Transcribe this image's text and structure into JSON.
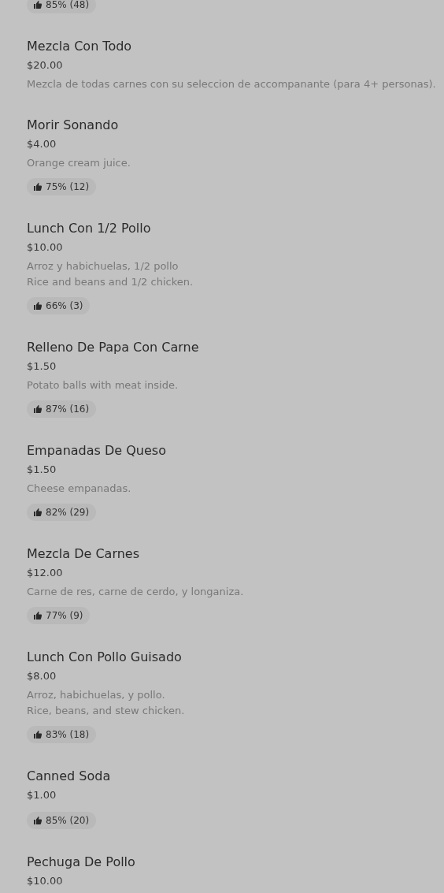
{
  "menu_items": [
    {
      "rating": "85% (48)"
    },
    {
      "name": "Mezcla Con Todo",
      "price": "$20.00",
      "description": [
        "Mezcla de todas carnes con su seleccion de accompanante (para 4+ personas)."
      ]
    },
    {
      "name": "Morir Sonando",
      "price": "$4.00",
      "description": [
        "Orange cream juice."
      ],
      "rating": "75% (12)"
    },
    {
      "name": "Lunch Con 1/2 Pollo",
      "price": "$10.00",
      "description": [
        "Arroz y habichuelas, 1/2 pollo",
        "Rice and beans and 1/2 chicken."
      ],
      "rating": "66% (3)"
    },
    {
      "name": "Relleno De Papa Con Carne",
      "price": "$1.50",
      "description": [
        "Potato balls with meat inside."
      ],
      "rating": "87% (16)"
    },
    {
      "name": "Empanadas De Queso",
      "price": "$1.50",
      "description": [
        "Cheese empanadas."
      ],
      "rating": "82% (29)"
    },
    {
      "name": "Mezcla De Carnes",
      "price": "$12.00",
      "description": [
        "Carne de res, carne de cerdo, y longaniza."
      ],
      "rating": "77% (9)"
    },
    {
      "name": "Lunch Con Pollo Guisado",
      "price": "$8.00",
      "description": [
        "Arroz, habichuelas, y pollo.",
        "Rice, beans, and stew chicken."
      ],
      "rating": "83% (18)"
    },
    {
      "name": "Canned Soda",
      "price": "$1.00",
      "rating": "85% (20)"
    },
    {
      "name": "Pechuga De Pollo",
      "price": "$10.00"
    }
  ]
}
